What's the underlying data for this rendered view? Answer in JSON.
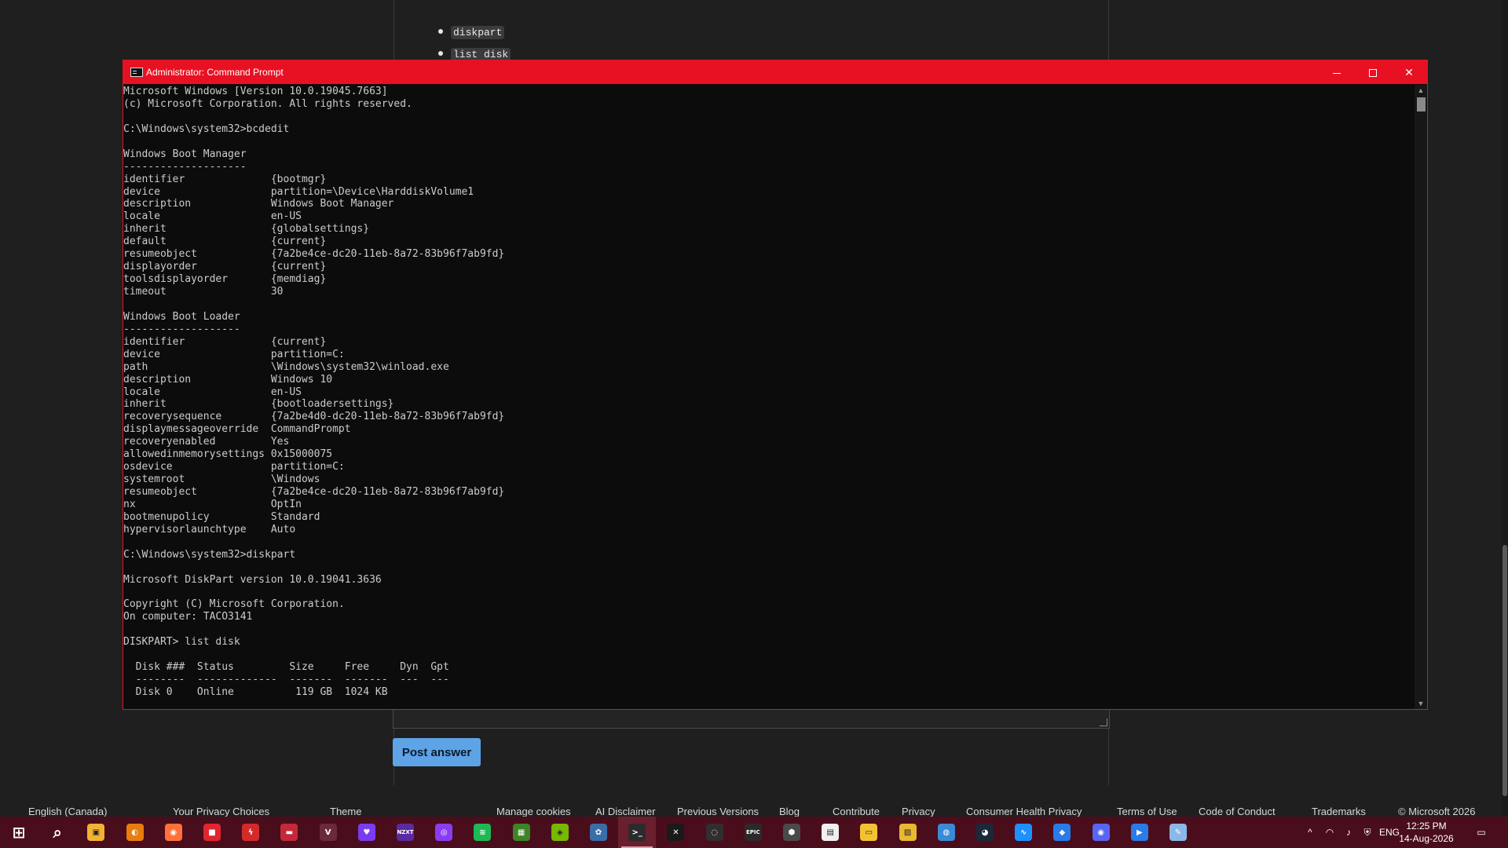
{
  "web_page": {
    "bullets": [
      "diskpart",
      "list disk"
    ],
    "post_button": "Post answer",
    "footer_items": [
      "English (Canada)",
      "Your Privacy Choices",
      "Theme",
      "Manage cookies",
      "AI Disclaimer",
      "Previous Versions",
      "Blog",
      "Contribute",
      "Privacy",
      "Consumer Health Privacy",
      "Terms of Use",
      "Code of Conduct",
      "Trademarks",
      "© Microsoft 2026"
    ]
  },
  "cmd_window": {
    "title": "Administrator: Command Prompt",
    "accent_color": "#e81123",
    "lines": [
      "Microsoft Windows [Version 10.0.19045.7663]",
      "(c) Microsoft Corporation. All rights reserved.",
      "",
      "C:\\Windows\\system32>bcdedit",
      "",
      "Windows Boot Manager",
      "--------------------",
      "identifier              {bootmgr}",
      "device                  partition=\\Device\\HarddiskVolume1",
      "description             Windows Boot Manager",
      "locale                  en-US",
      "inherit                 {globalsettings}",
      "default                 {current}",
      "resumeobject            {7a2be4ce-dc20-11eb-8a72-83b96f7ab9fd}",
      "displayorder            {current}",
      "toolsdisplayorder       {memdiag}",
      "timeout                 30",
      "",
      "Windows Boot Loader",
      "-------------------",
      "identifier              {current}",
      "device                  partition=C:",
      "path                    \\Windows\\system32\\winload.exe",
      "description             Windows 10",
      "locale                  en-US",
      "inherit                 {bootloadersettings}",
      "recoverysequence        {7a2be4d0-dc20-11eb-8a72-83b96f7ab9fd}",
      "displaymessageoverride  CommandPrompt",
      "recoveryenabled         Yes",
      "allowedinmemorysettings 0x15000075",
      "osdevice                partition=C:",
      "systemroot              \\Windows",
      "resumeobject            {7a2be4ce-dc20-11eb-8a72-83b96f7ab9fd}",
      "nx                      OptIn",
      "bootmenupolicy          Standard",
      "hypervisorlaunchtype    Auto",
      "",
      "C:\\Windows\\system32>diskpart",
      "",
      "Microsoft DiskPart version 10.0.19041.3636",
      "",
      "Copyright (C) Microsoft Corporation.",
      "On computer: TACO3141",
      "",
      "DISKPART> list disk",
      "",
      "  Disk ###  Status         Size     Free     Dyn  Gpt",
      "  --------  -------------  -------  -------  ---  ---",
      "  Disk 0    Online          119 GB  1024 KB"
    ]
  },
  "taskbar": {
    "apps": [
      {
        "name": "start",
        "color": "#ffffff",
        "glyph": "⊞"
      },
      {
        "name": "search",
        "color": "#ffffff",
        "glyph": "⌕"
      },
      {
        "name": "file-manager",
        "color": "#f2b233",
        "glyph": "▣"
      },
      {
        "name": "blender",
        "color": "#e87d0d",
        "glyph": "◐"
      },
      {
        "name": "firefox",
        "color": "#ff7139",
        "glyph": "◉"
      },
      {
        "name": "app-red-1",
        "color": "#e0262f",
        "glyph": "■"
      },
      {
        "name": "app-red-2",
        "color": "#d42a2a",
        "glyph": "ϟ"
      },
      {
        "name": "app-red-3",
        "color": "#c4293a",
        "glyph": "▬"
      },
      {
        "name": "app-v",
        "color": "#6b2a3a",
        "glyph": "V"
      },
      {
        "name": "app-heart",
        "color": "#7a3cf0",
        "glyph": "♥"
      },
      {
        "name": "nzxt",
        "color": "#5b2aa0",
        "glyph": "NZXT"
      },
      {
        "name": "podcast",
        "color": "#8a3cf0",
        "glyph": "◎"
      },
      {
        "name": "spotify",
        "color": "#1db954",
        "glyph": "≋"
      },
      {
        "name": "minecraft",
        "color": "#3c8527",
        "glyph": "▦"
      },
      {
        "name": "nvidia",
        "color": "#76b900",
        "glyph": "◈"
      },
      {
        "name": "davinci",
        "color": "#3a6ea8",
        "glyph": "✿"
      },
      {
        "name": "terminal",
        "color": "#2b2b2b",
        "glyph": ">_"
      },
      {
        "name": "app-x",
        "color": "#1a1a1a",
        "glyph": "✕"
      },
      {
        "name": "obs",
        "color": "#302e31",
        "glyph": "◌"
      },
      {
        "name": "epic-games",
        "color": "#2a2a2a",
        "glyph": "EPIC"
      },
      {
        "name": "app-hex",
        "color": "#4a4a4a",
        "glyph": "⬢"
      },
      {
        "name": "document",
        "color": "#f0f0f0",
        "glyph": "▤"
      },
      {
        "name": "explorer",
        "color": "#f2c233",
        "glyph": "▭"
      },
      {
        "name": "photos",
        "color": "#e8b830",
        "glyph": "▨"
      },
      {
        "name": "app-globe",
        "color": "#3a8ad8",
        "glyph": "◍"
      },
      {
        "name": "steam",
        "color": "#1b2838",
        "glyph": "◕"
      },
      {
        "name": "monitor",
        "color": "#1e90ff",
        "glyph": "∿"
      },
      {
        "name": "roblox",
        "color": "#2a7ae8",
        "glyph": "◆"
      },
      {
        "name": "discord",
        "color": "#5865f2",
        "glyph": "◉"
      },
      {
        "name": "app-blue",
        "color": "#2a7ae8",
        "glyph": "▶"
      },
      {
        "name": "app-pen",
        "color": "#8ab8e8",
        "glyph": "✎"
      }
    ],
    "tray": {
      "language": "ENG",
      "time": "12:25 PM",
      "date": "14-Aug-2026"
    }
  }
}
